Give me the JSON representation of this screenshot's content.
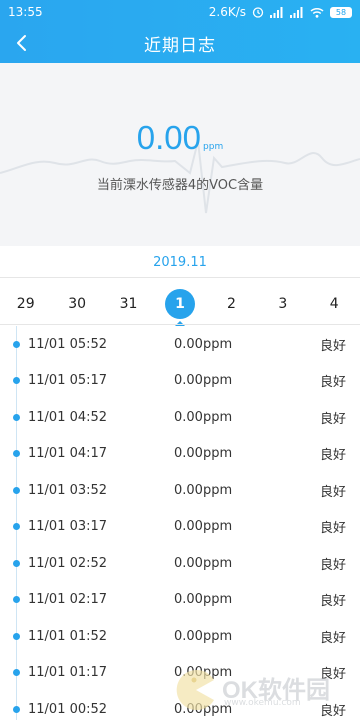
{
  "status_bar": {
    "time": "13:55",
    "network_speed": "2.6K/s",
    "battery": "58",
    "icons": [
      "alarm-icon",
      "signal-icon",
      "signal-icon",
      "wifi-icon",
      "battery-icon"
    ]
  },
  "header": {
    "title": "近期日志",
    "back_icon": "chevron-left-icon"
  },
  "reading": {
    "value": "0.00",
    "unit": "ppm",
    "caption": "当前溧水传感器4的VOC含量"
  },
  "month": "2019.11",
  "dates": [
    {
      "label": "29",
      "active": false
    },
    {
      "label": "30",
      "active": false
    },
    {
      "label": "31",
      "active": false
    },
    {
      "label": "1",
      "active": true
    },
    {
      "label": "2",
      "active": false
    },
    {
      "label": "3",
      "active": false
    },
    {
      "label": "4",
      "active": false
    }
  ],
  "logs": [
    {
      "time": "11/01 05:52",
      "value": "0.00ppm",
      "status": "良好"
    },
    {
      "time": "11/01 05:17",
      "value": "0.00ppm",
      "status": "良好"
    },
    {
      "time": "11/01 04:52",
      "value": "0.00ppm",
      "status": "良好"
    },
    {
      "time": "11/01 04:17",
      "value": "0.00ppm",
      "status": "良好"
    },
    {
      "time": "11/01 03:52",
      "value": "0.00ppm",
      "status": "良好"
    },
    {
      "time": "11/01 03:17",
      "value": "0.00ppm",
      "status": "良好"
    },
    {
      "time": "11/01 02:52",
      "value": "0.00ppm",
      "status": "良好"
    },
    {
      "time": "11/01 02:17",
      "value": "0.00ppm",
      "status": "良好"
    },
    {
      "time": "11/01 01:52",
      "value": "0.00ppm",
      "status": "良好"
    },
    {
      "time": "11/01 01:17",
      "value": "0.00ppm",
      "status": "良好"
    },
    {
      "time": "11/01 00:52",
      "value": "0.00ppm",
      "status": "良好"
    }
  ],
  "watermark": {
    "text": "OK软件园",
    "url": "www.okemu.com"
  },
  "colors": {
    "accent": "#27a3ec",
    "header_bg": "#2aa6ef",
    "hero_bg": "#f4f5f7"
  }
}
